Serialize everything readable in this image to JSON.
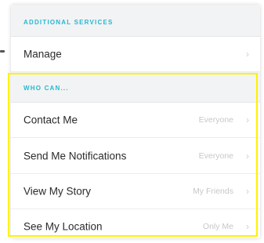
{
  "additional_services": {
    "header": "ADDITIONAL SERVICES",
    "manage": {
      "label": "Manage",
      "chevron": "›"
    }
  },
  "who_can": {
    "header": "WHO CAN...",
    "rows": [
      {
        "label": "Contact Me",
        "value": "Everyone",
        "chevron": "›"
      },
      {
        "label": "Send Me Notifications",
        "value": "Everyone",
        "chevron": "›"
      },
      {
        "label": "View My Story",
        "value": "My Friends",
        "chevron": "›"
      },
      {
        "label": "See My Location",
        "value": "Only Me",
        "chevron": "›"
      }
    ]
  },
  "colors": {
    "header_text": "#25b8cf",
    "highlight_border": "#fff200"
  },
  "icons": {
    "chevron": "chevron-right-icon"
  }
}
